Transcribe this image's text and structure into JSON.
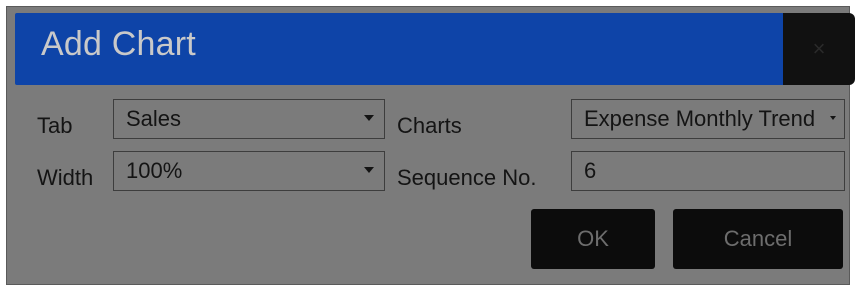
{
  "dialog": {
    "title": "Add Chart",
    "close_glyph": "×"
  },
  "form": {
    "tab_label": "Tab",
    "tab_value": "Sales",
    "width_label": "Width",
    "width_value": "100%",
    "charts_label": "Charts",
    "charts_value": "Expense Monthly Trend",
    "sequence_label": "Sequence No.",
    "sequence_value": "6"
  },
  "buttons": {
    "ok": "OK",
    "cancel": "Cancel"
  },
  "icons": {
    "close": "close-icon",
    "dropdown": "chevron-down-icon"
  }
}
